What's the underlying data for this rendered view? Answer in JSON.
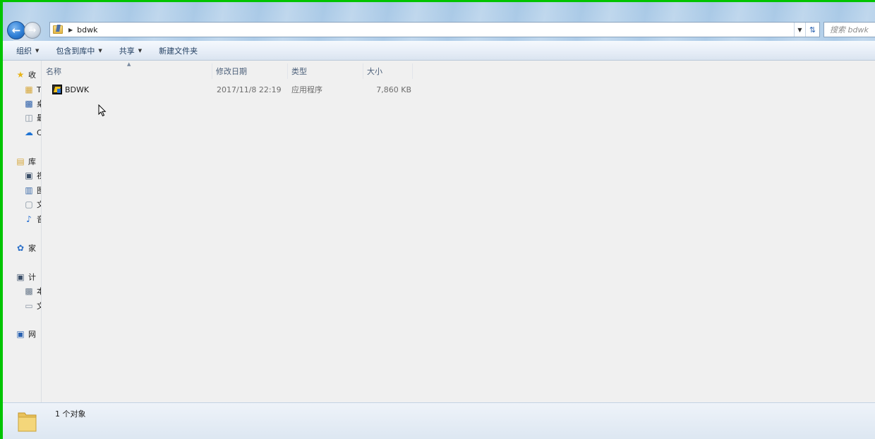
{
  "address": {
    "path": "bdwk",
    "search_placeholder": "搜索 bdwk"
  },
  "toolbar": {
    "organize": "组织",
    "include_in_library": "包含到库中",
    "share": "共享",
    "new_folder": "新建文件夹"
  },
  "nav_pane": {
    "favorites": "收",
    "fav_downloads": "T",
    "fav_desktop": "桌",
    "fav_recent": "最",
    "fav_onedrive": "C",
    "libraries": "库",
    "lib_videos": "视",
    "lib_pictures": "图",
    "lib_documents": "文",
    "lib_music": "音",
    "homegroup": "家",
    "computer": "计",
    "comp_local_disk": "本",
    "comp_drive": "文",
    "network": "网"
  },
  "columns": {
    "name": "名称",
    "date": "修改日期",
    "type": "类型",
    "size": "大小"
  },
  "files": [
    {
      "name": "BDWK",
      "date": "2017/11/8 22:19",
      "type": "应用程序",
      "size": "7,860 KB"
    }
  ],
  "status": {
    "count": "1 个对象"
  },
  "colors": {
    "window_frame": "#00c400",
    "titlebar_blue": "#a9c9e6",
    "content_bg": "#f0f0f0",
    "header_text": "#4c607a"
  }
}
